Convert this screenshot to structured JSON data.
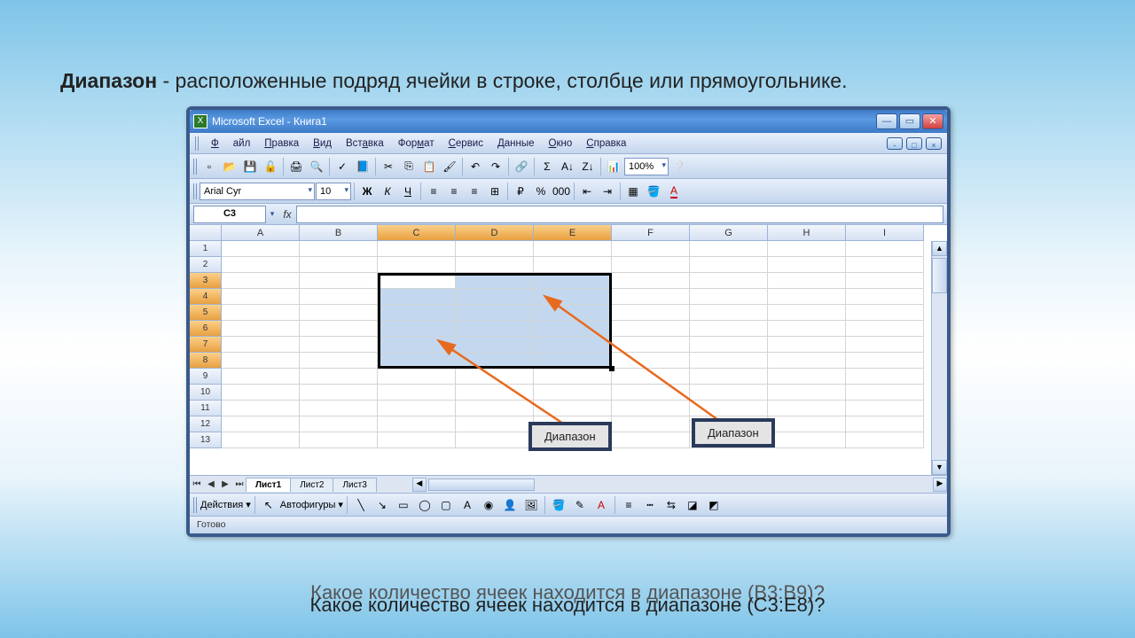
{
  "slide": {
    "term": "Диапазон",
    "definition": " - расположенные подряд ячейки в строке, столбце или прямоугольнике."
  },
  "window": {
    "title": "Microsoft Excel - Книга1"
  },
  "menu": {
    "file": "Файл",
    "edit": "Правка",
    "view": "Вид",
    "insert": "Вставка",
    "format": "Формат",
    "tools": "Сервис",
    "data": "Данные",
    "window": "Окно",
    "help": "Справка"
  },
  "toolbar": {
    "font": "Arial Cyr",
    "size": "10",
    "zoom": "100%"
  },
  "namebox": "C3",
  "columns": [
    "A",
    "B",
    "C",
    "D",
    "E",
    "F",
    "G",
    "H",
    "I"
  ],
  "rows": [
    "1",
    "2",
    "3",
    "4",
    "5",
    "6",
    "7",
    "8",
    "9",
    "10",
    "11",
    "12",
    "13"
  ],
  "tabs": {
    "s1": "Лист1",
    "s2": "Лист2",
    "s3": "Лист3"
  },
  "drawbar": {
    "actions": "Действия",
    "autoshapes": "Автофигуры"
  },
  "status": "Готово",
  "callouts": {
    "range1": "Диапазон",
    "range2": "Диапазон"
  },
  "questions": {
    "q1": "Какое количество ячеек находится в диапазоне (B3:B9)?",
    "q2": "Какое количество ячеек находится в диапазоне (C3:E8)?"
  }
}
